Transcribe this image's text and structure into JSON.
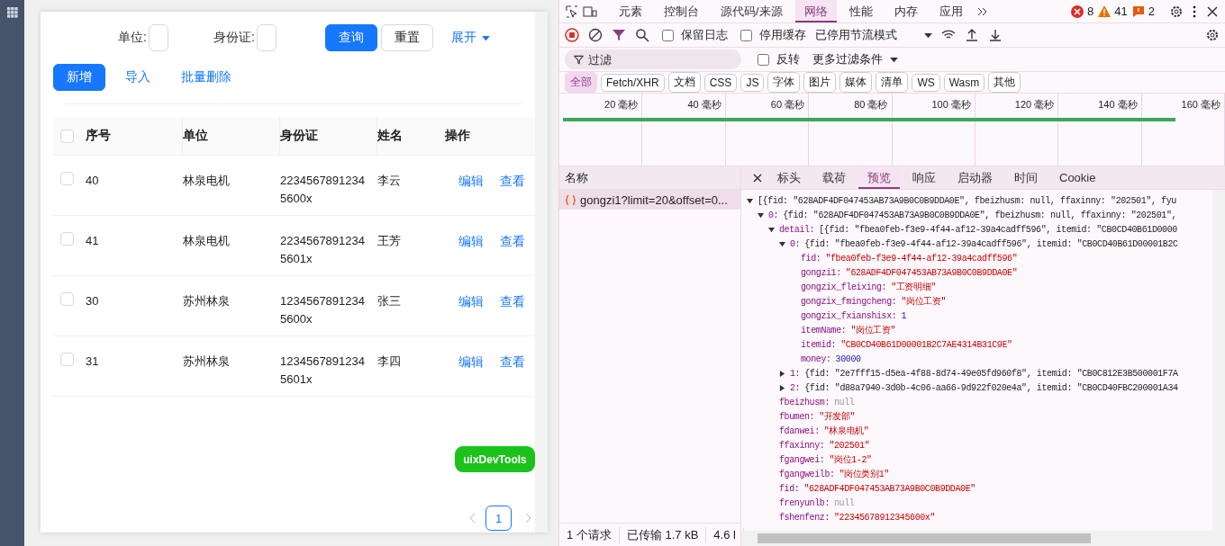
{
  "app": {
    "filters": [
      {
        "label": "单位:"
      },
      {
        "label": "身份证:"
      }
    ],
    "buttons": [
      {
        "label": "查询",
        "kind": "primary"
      },
      {
        "label": "重置",
        "kind": "default"
      },
      {
        "label": "展开",
        "kind": "link"
      }
    ],
    "actions": [
      {
        "label": "新增",
        "kind": "primary"
      },
      {
        "label": "导入",
        "kind": "link"
      },
      {
        "label": "批量删除",
        "kind": "link"
      }
    ],
    "table": {
      "columns": [
        "序号",
        "单位",
        "身份证",
        "姓名",
        "操作"
      ],
      "all_checked": false,
      "rows": [
        {
          "checked": false,
          "cells": [
            "40",
            "林泉电机",
            "2234567891234 5600x",
            "李云"
          ],
          "actions": [
            "编辑",
            "查看"
          ]
        },
        {
          "checked": false,
          "cells": [
            "41",
            "林泉电机",
            "2234567891234 5601x",
            "王芳"
          ],
          "actions": [
            "编辑",
            "查看"
          ]
        },
        {
          "checked": false,
          "cells": [
            "30",
            "苏州林泉",
            "1234567891234 5600x",
            "张三"
          ],
          "actions": [
            "编辑",
            "查看"
          ]
        },
        {
          "checked": false,
          "cells": [
            "31",
            "苏州林泉",
            "1234567891234 5601x",
            "李四"
          ],
          "actions": [
            "编辑",
            "查看"
          ]
        }
      ]
    },
    "floating_button": "uixDevTools",
    "pagination": [
      {
        "label": "1",
        "selected": true
      }
    ]
  },
  "devtools": {
    "tabs": [
      {
        "label": "元素",
        "selected": false
      },
      {
        "label": "控制台",
        "selected": false
      },
      {
        "label": "源代码/来源",
        "selected": false
      },
      {
        "label": "网络",
        "selected": true
      },
      {
        "label": "性能",
        "selected": false
      },
      {
        "label": "内存",
        "selected": false
      },
      {
        "label": "应用",
        "selected": false
      }
    ],
    "counts": [
      {
        "kind": "error",
        "text": "8"
      },
      {
        "kind": "warning",
        "text": "41"
      },
      {
        "kind": "info",
        "text": "2"
      }
    ],
    "toolbar": {
      "checkboxes": [
        {
          "label": "保留日志",
          "checked": false
        },
        {
          "label": "停用缓存",
          "checked": false
        }
      ],
      "throttling": "已停用节流模式"
    },
    "filter": {
      "placeholder": "过滤",
      "invert": {
        "label": "反转",
        "checked": false
      },
      "more": "更多过滤条件"
    },
    "types": [
      {
        "label": "全部",
        "selected": true
      },
      {
        "label": "Fetch/XHR",
        "selected": false
      },
      {
        "label": "文档",
        "selected": false
      },
      {
        "label": "CSS",
        "selected": false
      },
      {
        "label": "JS",
        "selected": false
      },
      {
        "label": "字体",
        "selected": false
      },
      {
        "label": "图片",
        "selected": false
      },
      {
        "label": "媒体",
        "selected": false
      },
      {
        "label": "清单",
        "selected": false
      },
      {
        "label": "WS",
        "selected": false
      },
      {
        "label": "Wasm",
        "selected": false
      },
      {
        "label": "其他",
        "selected": false
      }
    ],
    "timeline_ticks": [
      "20 毫秒",
      "40 毫秒",
      "60 毫秒",
      "80 毫秒",
      "100 毫秒",
      "120 毫秒",
      "140 毫秒",
      "160 毫秒"
    ],
    "requests": {
      "header": "名称",
      "items": [
        {
          "name": "gongzi1?limit=20&offset=0...",
          "selected": true
        }
      ]
    },
    "detail_tabs": [
      {
        "label": "标头",
        "selected": false
      },
      {
        "label": "载荷",
        "selected": false
      },
      {
        "label": "预览",
        "selected": true
      },
      {
        "label": "响应",
        "selected": false
      },
      {
        "label": "启动器",
        "selected": false
      },
      {
        "label": "时间",
        "selected": false
      },
      {
        "label": "Cookie",
        "selected": false
      }
    ],
    "preview": [
      {
        "kind": "object",
        "value": "[{fid: \"628ADF4DF047453AB73A9B0C0B9DDA0E\", fbeizhusm: null, ffaxinny: \"202501\", fyu",
        "expanded": true,
        "children": [
          {
            "key": "0:",
            "kind": "object",
            "value": "{fid: \"628ADF4DF047453AB73A9B0C0B9DDA0E\", fbeizhusm: null, ffaxinny: \"202501\",",
            "expanded": true,
            "children": [
              {
                "key": "detail:",
                "kind": "object",
                "value": "[{fid: \"fbea0feb-f3e9-4f44-af12-39a4cadff596\", itemid: \"CB0CD40B61D0000",
                "expanded": true,
                "children": [
                  {
                    "key": "0:",
                    "kind": "object",
                    "value": "{fid: \"fbea0feb-f3e9-4f44-af12-39a4cadff596\", itemid: \"CB0CD40B61D00001B2C",
                    "expanded": true,
                    "children": [
                      {
                        "key": "fid:",
                        "kind": "string",
                        "value": "\"fbea0feb-f3e9-4f44-af12-39a4cadff596\""
                      },
                      {
                        "key": "gongzi1:",
                        "kind": "string",
                        "value": "\"628ADF4DF047453AB73A9B0C0B9DDA0E\""
                      },
                      {
                        "key": "gongzix_fleixing:",
                        "kind": "string",
                        "value": "\"工资明细\""
                      },
                      {
                        "key": "gongzix_fmingcheng:",
                        "kind": "string",
                        "value": "\"岗位工资\""
                      },
                      {
                        "key": "gongzix_fxianshisx:",
                        "kind": "number",
                        "value": "1"
                      },
                      {
                        "key": "itemName:",
                        "kind": "string",
                        "value": "\"岗位工资\""
                      },
                      {
                        "key": "itemid:",
                        "kind": "string",
                        "value": "\"CB0CD40B61D00001B2C7AE4314B31C9E\""
                      },
                      {
                        "key": "money:",
                        "kind": "number",
                        "value": "30000"
                      }
                    ]
                  },
                  {
                    "key": "1:",
                    "kind": "object",
                    "value": "{fid: \"2e7fff15-d5ea-4f88-8d74-49e05fd960f8\", itemid: \"CB0C812E3B500001F7A",
                    "expanded": false
                  },
                  {
                    "key": "2:",
                    "kind": "object",
                    "value": "{fid: \"d88a7940-3d0b-4c06-aa66-9d922f020e4a\", itemid: \"CB0CD40FBC200001A34",
                    "expanded": false
                  }
                ]
              },
              {
                "key": "fbeizhusm:",
                "kind": "null",
                "value": "null"
              },
              {
                "key": "fbumen:",
                "kind": "string",
                "value": "\"开发部\""
              },
              {
                "key": "fdanwei:",
                "kind": "string",
                "value": "\"林泉电机\""
              },
              {
                "key": "ffaxinny:",
                "kind": "string",
                "value": "\"202501\""
              },
              {
                "key": "fgangwei:",
                "kind": "string",
                "value": "\"岗位1-2\""
              },
              {
                "key": "fgangweilb:",
                "kind": "string",
                "value": "\"岗位类别1\""
              },
              {
                "key": "fid:",
                "kind": "string",
                "value": "\"628ADF4DF047453AB73A9B0C0B9DDA0E\""
              },
              {
                "key": "frenyunlb:",
                "kind": "null",
                "value": "null"
              },
              {
                "key": "fshenfenz:",
                "kind": "string",
                "value": "\"22345678912345600x\""
              }
            ]
          }
        ]
      }
    ],
    "status": [
      "1 个请求",
      "已传输 1.7 kB",
      "4.6 l"
    ]
  }
}
